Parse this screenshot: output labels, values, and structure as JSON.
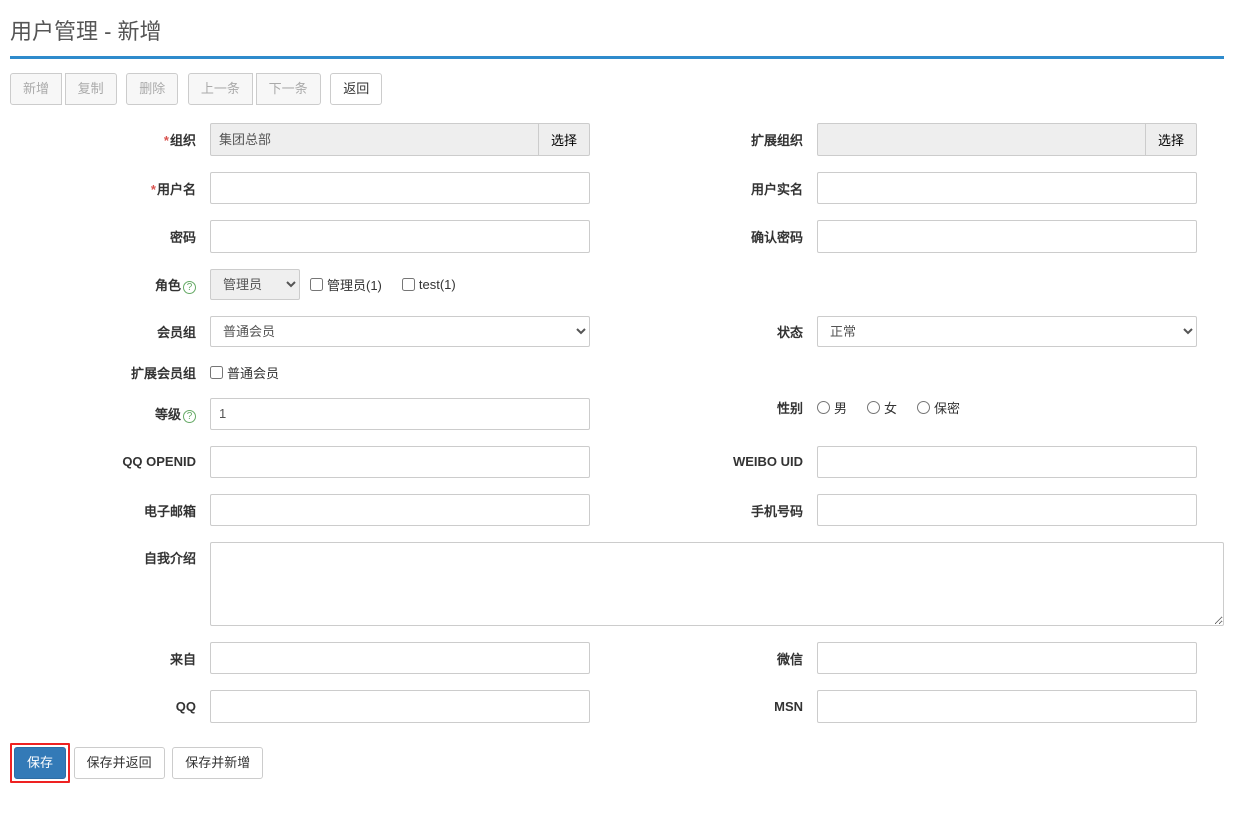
{
  "title": "用户管理 - 新增",
  "toolbar": {
    "new": "新增",
    "copy": "复制",
    "delete": "删除",
    "prev": "上一条",
    "next": "下一条",
    "back": "返回"
  },
  "labels": {
    "org": "组织",
    "ext_org": "扩展组织",
    "username": "用户名",
    "realname": "用户实名",
    "password": "密码",
    "confirm_password": "确认密码",
    "role": "角色",
    "group": "会员组",
    "status": "状态",
    "ext_group": "扩展会员组",
    "level": "等级",
    "gender": "性别",
    "qq_openid": "QQ OPENID",
    "weibo_uid": "WEIBO UID",
    "email": "电子邮箱",
    "mobile": "手机号码",
    "bio": "自我介绍",
    "from": "来自",
    "wechat": "微信",
    "qq": "QQ",
    "msn": "MSN"
  },
  "values": {
    "org": "集团总部",
    "ext_org": "",
    "username": "",
    "realname": "",
    "password": "",
    "confirm_password": "",
    "role_select": "管理员",
    "group_select": "普通会员",
    "status_select": "正常",
    "level": "1",
    "qq_openid": "",
    "weibo_uid": "",
    "email": "",
    "mobile": "",
    "bio": "",
    "from": "",
    "wechat": "",
    "qq": "",
    "msn": ""
  },
  "role_checkboxes": [
    {
      "label": "管理员(1)",
      "checked": false
    },
    {
      "label": "test(1)",
      "checked": false
    }
  ],
  "ext_group_checkboxes": [
    {
      "label": "普通会员",
      "checked": false
    }
  ],
  "gender_options": [
    {
      "label": "男"
    },
    {
      "label": "女"
    },
    {
      "label": "保密"
    }
  ],
  "buttons": {
    "select": "选择",
    "save": "保存",
    "save_back": "保存并返回",
    "save_new": "保存并新增"
  }
}
